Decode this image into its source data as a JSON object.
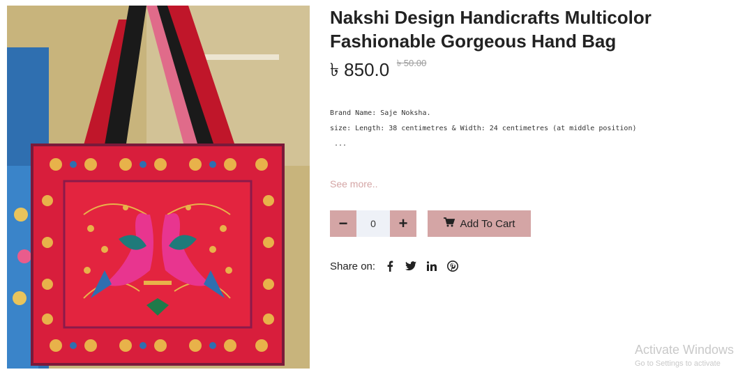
{
  "product": {
    "title": "Nakshi Design Handicrafts Multicolor Fashionable Gorgeous Hand Bag",
    "price": "৳ 850.0",
    "old_price": "৳ 50.00",
    "description_lines": [
      "Brand Name: Saje Noksha.",
      "size: Length: 38 centimetres & Width: 24 centimetres (at middle position)",
      " ..."
    ],
    "see_more_label": "See more..",
    "image_icon": "handbag-photo"
  },
  "cart": {
    "minus_label": "−",
    "plus_label": "+",
    "quantity_value": "0",
    "add_to_cart_label": "Add To Cart",
    "cart_icon": "shopping-cart-icon"
  },
  "share": {
    "label": "Share on:",
    "networks": [
      "facebook",
      "twitter",
      "linkedin",
      "pinterest"
    ]
  },
  "watermark": {
    "title": "Activate Windows",
    "subtitle": "Go to Settings to activate"
  },
  "colors": {
    "accent": "#d4a5a5",
    "input_bg": "#eef1f7",
    "see_more": "#d4a5a5",
    "old_price": "#9b9b9b"
  }
}
